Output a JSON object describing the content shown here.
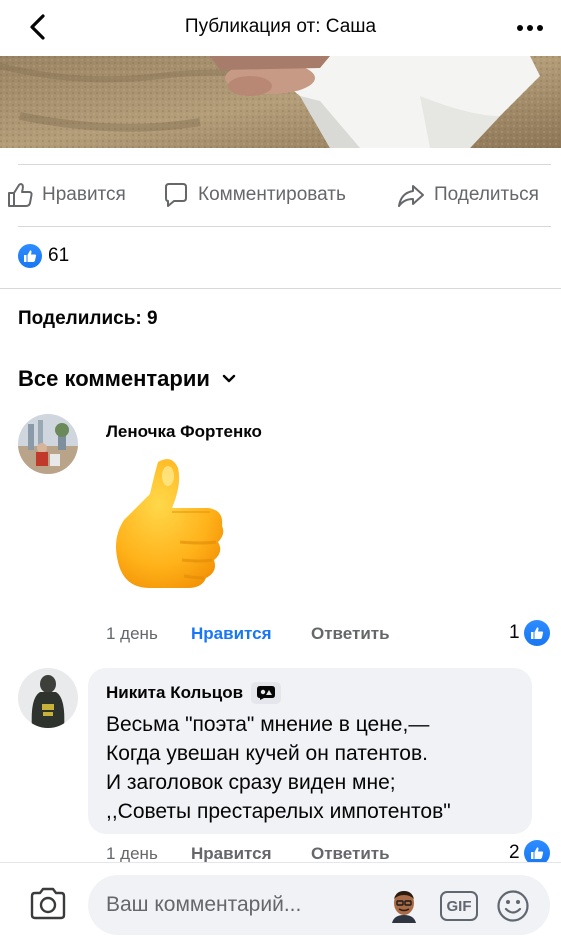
{
  "header": {
    "title": "Публикация от: Саша"
  },
  "actions": {
    "like": "Нравится",
    "comment": "Комментировать",
    "share": "Поделиться"
  },
  "reactions": {
    "count": "61"
  },
  "shares": {
    "label": "Поделились: 9"
  },
  "comments_filter": {
    "label": "Все комментарии"
  },
  "comments": [
    {
      "author": "Леночка Фортенко",
      "time": "1 день",
      "like": "Нравится",
      "reply": "Ответить",
      "reactions": "1"
    },
    {
      "author": "Никита Кольцов",
      "lines": [
        "Весьма \"поэта\" мнение в цене,—",
        "Когда увешан кучей он патентов.",
        "И заголовок сразу виден мне;",
        ",,Советы престарелых импотентов\""
      ],
      "time": "1 день",
      "like": "Нравится",
      "reply": "Ответить",
      "reactions": "2"
    }
  ],
  "composer": {
    "placeholder": "Ваш комментарий...",
    "gif_label": "GIF"
  }
}
